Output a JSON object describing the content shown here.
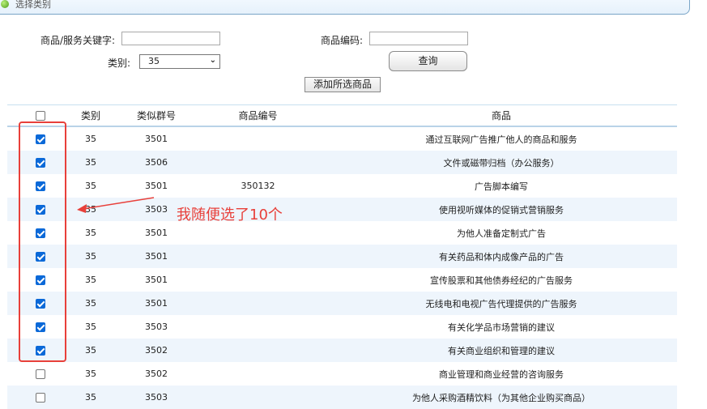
{
  "header": {
    "title": "选择类别"
  },
  "search": {
    "keyword_label": "商品/服务关键字:",
    "keyword_value": "",
    "code_label": "商品编码:",
    "code_value": "",
    "category_label": "类别:",
    "category_value": "35",
    "query_button": "查询",
    "add_button": "添加所选商品"
  },
  "table": {
    "headers": {
      "category": "类别",
      "group": "类似群号",
      "code": "商品编号",
      "name": "商品"
    },
    "rows": [
      {
        "checked": true,
        "category": "35",
        "group": "3501",
        "code": "",
        "name": "通过互联网广告推广他人的商品和服务"
      },
      {
        "checked": true,
        "category": "35",
        "group": "3506",
        "code": "",
        "name": "文件或磁带归档（办公服务）"
      },
      {
        "checked": true,
        "category": "35",
        "group": "3501",
        "code": "350132",
        "name": "广告脚本编写"
      },
      {
        "checked": true,
        "category": "35",
        "group": "3503",
        "code": "",
        "name": "使用视听媒体的促销式营销服务"
      },
      {
        "checked": true,
        "category": "35",
        "group": "3501",
        "code": "",
        "name": "为他人准备定制式广告"
      },
      {
        "checked": true,
        "category": "35",
        "group": "3501",
        "code": "",
        "name": "有关药品和体内成像产品的广告"
      },
      {
        "checked": true,
        "category": "35",
        "group": "3501",
        "code": "",
        "name": "宣传股票和其他债券经纪的广告服务"
      },
      {
        "checked": true,
        "category": "35",
        "group": "3501",
        "code": "",
        "name": "无线电和电视广告代理提供的广告服务"
      },
      {
        "checked": true,
        "category": "35",
        "group": "3503",
        "code": "",
        "name": "有关化学品市场营销的建议"
      },
      {
        "checked": true,
        "category": "35",
        "group": "3502",
        "code": "",
        "name": "有关商业组织和管理的建议"
      },
      {
        "checked": false,
        "category": "35",
        "group": "3502",
        "code": "",
        "name": "商业管理和商业经营的咨询服务"
      },
      {
        "checked": false,
        "category": "35",
        "group": "3503",
        "code": "",
        "name": "为他人采购酒精饮料（为其他企业购买商品）"
      }
    ]
  },
  "annotation": {
    "text": "我随便选了10个",
    "color": "#e8403a"
  },
  "colors": {
    "checkbox_checked": "#0b69d8",
    "row_alt": "#eef5fc",
    "annotation_red": "#e8403a"
  }
}
